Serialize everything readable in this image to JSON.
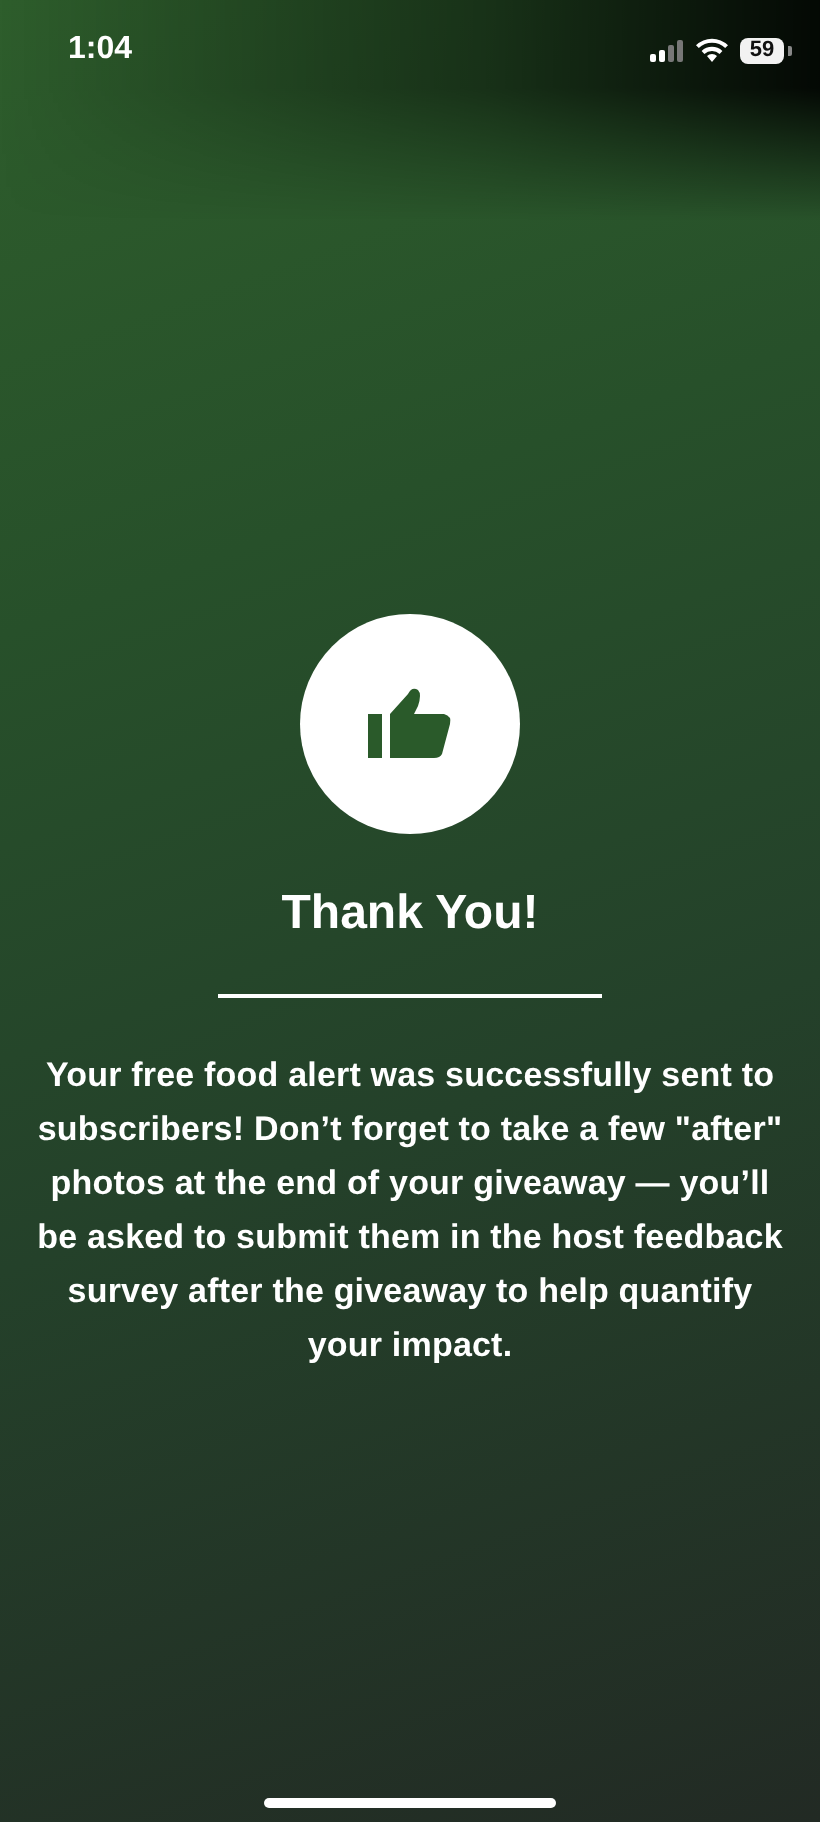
{
  "status_bar": {
    "time": "1:04",
    "battery": "59"
  },
  "title": "Thank You!",
  "message": "Your free food alert was successfully sent to subscribers! Don’t forget to take a few \"after\" photos at the end of your giveaway — you’ll be asked to submit them in the host feedback survey after the giveaway to help quantify your impact."
}
